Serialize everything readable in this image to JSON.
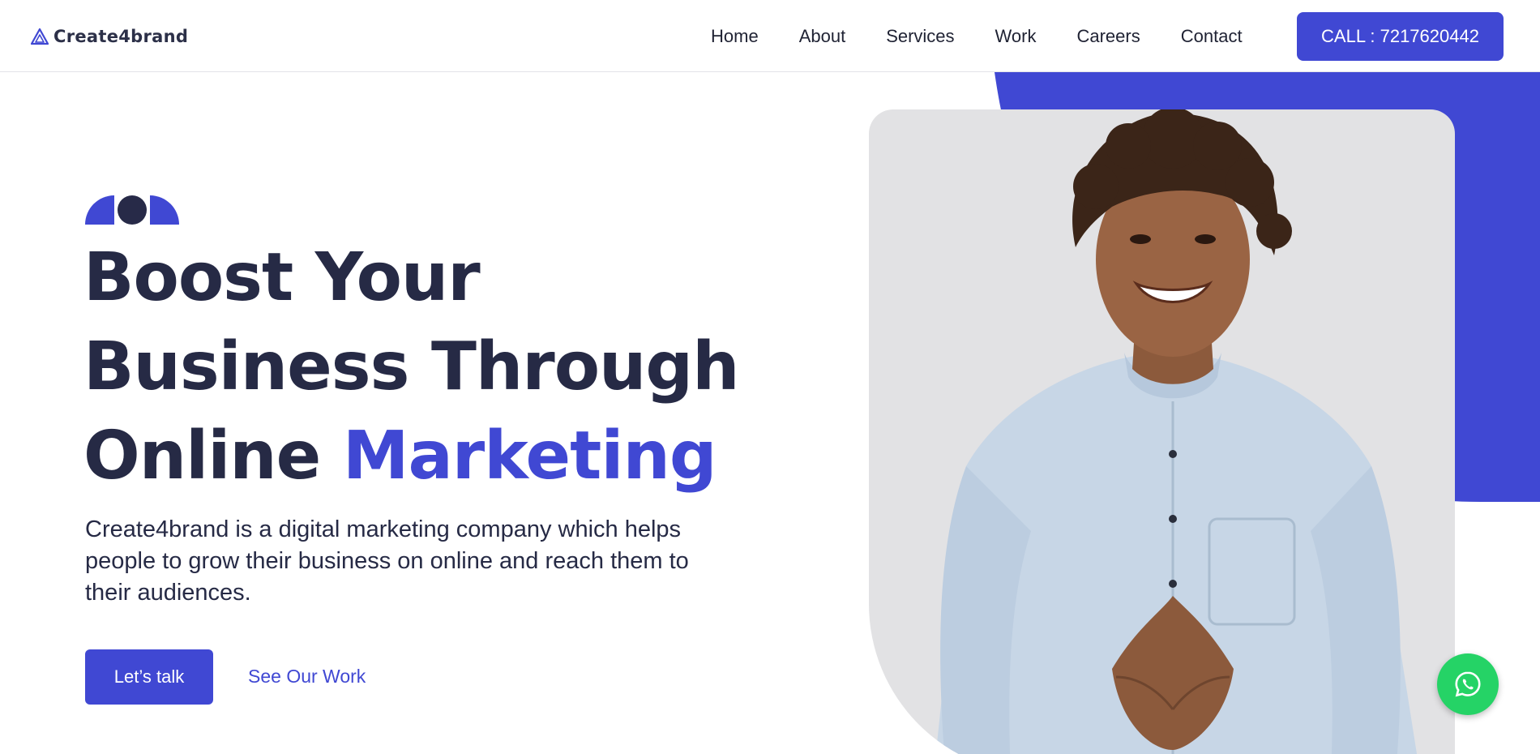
{
  "header": {
    "logo_text": "Create4brand",
    "nav": [
      "Home",
      "About",
      "Services",
      "Work",
      "Careers",
      "Contact"
    ],
    "call_label": "CALL : 7217620442"
  },
  "hero": {
    "headline_line1": "Boost Your",
    "headline_line2": "Business Through",
    "headline_line3_plain": "Online ",
    "headline_line3_accent": "Marketing",
    "description": "Create4brand is a digital marketing company which helps people to grow their business on online and reach them to their audiences.",
    "primary_button": "Let’s talk",
    "secondary_link": "See Our Work"
  },
  "colors": {
    "accent": "#4048d3",
    "dark": "#262a45",
    "card": "#e2e2e4",
    "whatsapp": "#25d366"
  },
  "icons": {
    "logo": "triangle-logo-icon",
    "whatsapp": "whatsapp-icon"
  }
}
